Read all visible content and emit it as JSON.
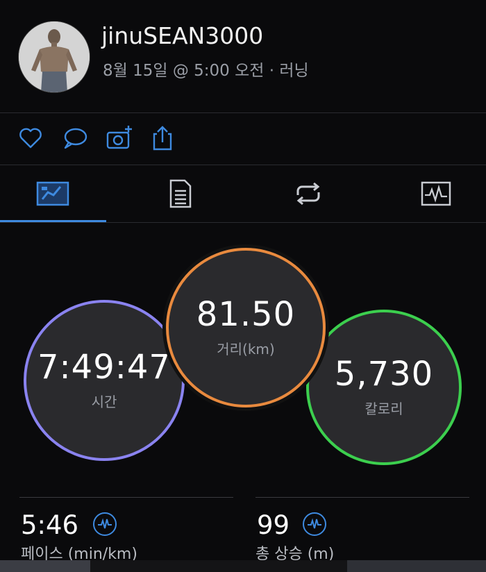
{
  "header": {
    "username": "jinuSEAN3000",
    "subtitle": "8월 15일 @ 5:00 오전 · 러닝"
  },
  "actions": [
    {
      "icon": "heart-icon"
    },
    {
      "icon": "comment-icon"
    },
    {
      "icon": "add-photo-icon"
    },
    {
      "icon": "share-icon"
    }
  ],
  "tabs": [
    {
      "icon": "overview-icon",
      "active": true
    },
    {
      "icon": "details-icon",
      "active": false
    },
    {
      "icon": "laps-icon",
      "active": false
    },
    {
      "icon": "chart-icon",
      "active": false
    }
  ],
  "metrics": {
    "time": {
      "value": "7:49:47",
      "label": "시간",
      "color": "#8a83f0"
    },
    "distance": {
      "value": "81.50",
      "label": "거리(km)",
      "color": "#e98a3e"
    },
    "calories": {
      "value": "5,730",
      "label": "칼로리",
      "color": "#3ccf4e"
    }
  },
  "stats": {
    "pace": {
      "value": "5:46",
      "label": "페이스 (min/km)"
    },
    "elevation": {
      "value": "99",
      "label": "총 상승 (m)"
    }
  },
  "colors": {
    "accent": "#3e8ae0",
    "background": "#0a0a0c"
  }
}
